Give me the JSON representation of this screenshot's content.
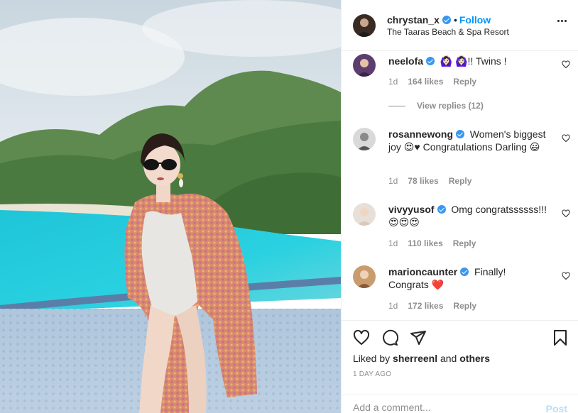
{
  "post": {
    "username": "chrystan_x",
    "location": "The Taaras Beach & Spa Resort",
    "follow_label": "Follow",
    "dot": "•"
  },
  "comments": [
    {
      "username": "neelofa",
      "text": "🙆🏻‍♀️ 🙆🏻‍♀️!! Twins !",
      "time": "1d",
      "likes": "164 likes",
      "reply_label": "Reply",
      "view_replies": "View replies (12)"
    },
    {
      "username": "rosannewong",
      "text": "Women's biggest joy 😍♥ Congratulations Darling 😃",
      "time": "1d",
      "likes": "78 likes",
      "reply_label": "Reply"
    },
    {
      "username": "vivyyusof",
      "text": "Omg congratssssss!!! 😍😍😍",
      "time": "1d",
      "likes": "110 likes",
      "reply_label": "Reply"
    },
    {
      "username": "marioncaunter",
      "text": "Finally! Congrats ❤️",
      "time": "1d",
      "likes": "172 likes",
      "reply_label": "Reply"
    }
  ],
  "footer": {
    "liked_by_prefix": "Liked by ",
    "liked_by_user": "sherreenl",
    "liked_by_suffix": " and ",
    "liked_by_others": "others",
    "timestamp": "1 DAY AGO",
    "comment_placeholder": "Add a comment...",
    "post_label": "Post"
  },
  "colors": {
    "accent": "#0095f6",
    "verified": "#3897f0",
    "heart_red": "#ed4956",
    "muted": "#8e8e8e"
  },
  "icons": [
    "verified-badge-icon",
    "more-options-icon",
    "heart-icon",
    "comment-icon",
    "share-icon",
    "bookmark-icon"
  ]
}
